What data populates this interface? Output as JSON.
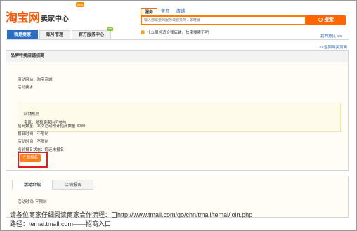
{
  "logo": {
    "main": "淘宝网",
    "sub": "卖家中心",
    "beta": "Beta"
  },
  "search": {
    "tabs": [
      "服务",
      "宝贝",
      "店铺"
    ],
    "active_tab": 0,
    "placeholder": "输入您需要的服务或服务商，如旺铺",
    "button_label": "搜索"
  },
  "hint": {
    "text": "什么服务适合我店铺，快来搜索下吧!"
  },
  "feedback": "我的意见 >>",
  "nav": [
    {
      "label": "我是卖家",
      "active": true
    },
    {
      "label": "账号管理",
      "active": false
    },
    {
      "label": "官方服务中心",
      "active": false,
      "badge": "new"
    }
  ],
  "back_link": "<<返回购买页面",
  "panel": {
    "title": "品牌特卖店铺招商",
    "fields": {
      "activity_site": "活动网站：淘宝商城",
      "activity_req": "活动要求：",
      "req_lines": [
        "店铺规则",
        "卖家：所有卖家均可参与"
      ],
      "recruit_count": "招商数量：本次活动预计招商数量 8000",
      "signup_time": "报名时间：不限制",
      "activity_time": "活动时间：不限制",
      "current_status": "当前报名状态：您还未报名"
    },
    "join_button": "立即报名"
  },
  "tabs": {
    "items": [
      "活动介绍",
      "店铺报名"
    ],
    "active": 0,
    "body": "活动时间: 不限制"
  },
  "bottom": {
    "line1_prefix": "请各位商家仔细阅读商家合作流程：",
    "line1_url": "http://www.tmall.com/go/chn/tmall/temai/join.php",
    "line2": "路径：temai.tmall.com——招商入口"
  }
}
